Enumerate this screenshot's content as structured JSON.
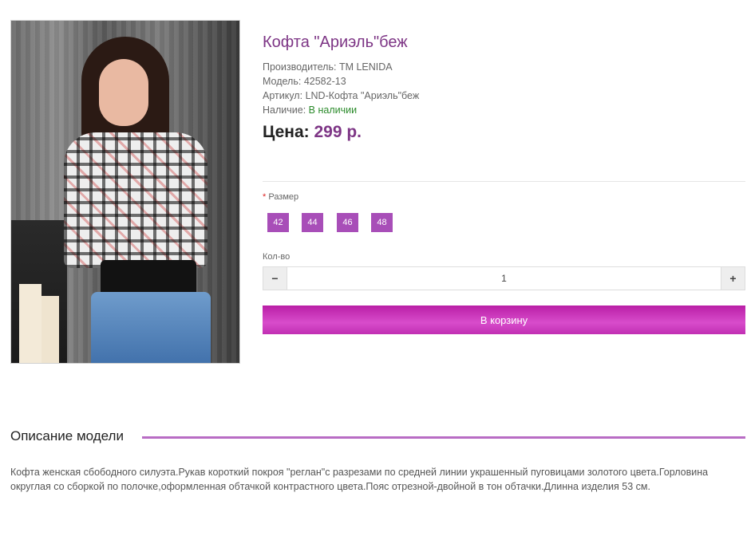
{
  "product": {
    "title": "Кофта \"Ариэль\"беж",
    "manufacturer_label": "Производитель:",
    "manufacturer": "TM LENIDA",
    "model_label": "Модель:",
    "model": "42582-13",
    "sku_label": "Артикул:",
    "sku": "LND-Кофта \"Ариэль\"беж",
    "availability_label": "Наличие:",
    "availability": "В наличии",
    "price_label": "Цена:",
    "price": "299 р."
  },
  "options": {
    "required_mark": "*",
    "size_label": "Размер",
    "sizes": [
      "42",
      "44",
      "46",
      "48"
    ],
    "qty_label": "Кол-во",
    "qty_value": "1",
    "minus_symbol": "−",
    "plus_symbol": "+"
  },
  "cart_button": "В корзину",
  "description": {
    "heading": "Описание модели",
    "text": "Кофта женская сбободного силуэта.Рукав короткий покроя \"реглан\"с разрезами по средней линии украшенный пуговицами золотого цвета.Горловина округлая со сборкой по полочке,оформленная обтачкой контрастного цвета.Пояс отрезной-двойной в тон обтачки.Длинна изделия 53 см."
  },
  "colors": {
    "accent": "#7d3585",
    "size_button": "#a84eb8",
    "cart_button": "#c12fb3",
    "in_stock": "#2a8a2a"
  }
}
